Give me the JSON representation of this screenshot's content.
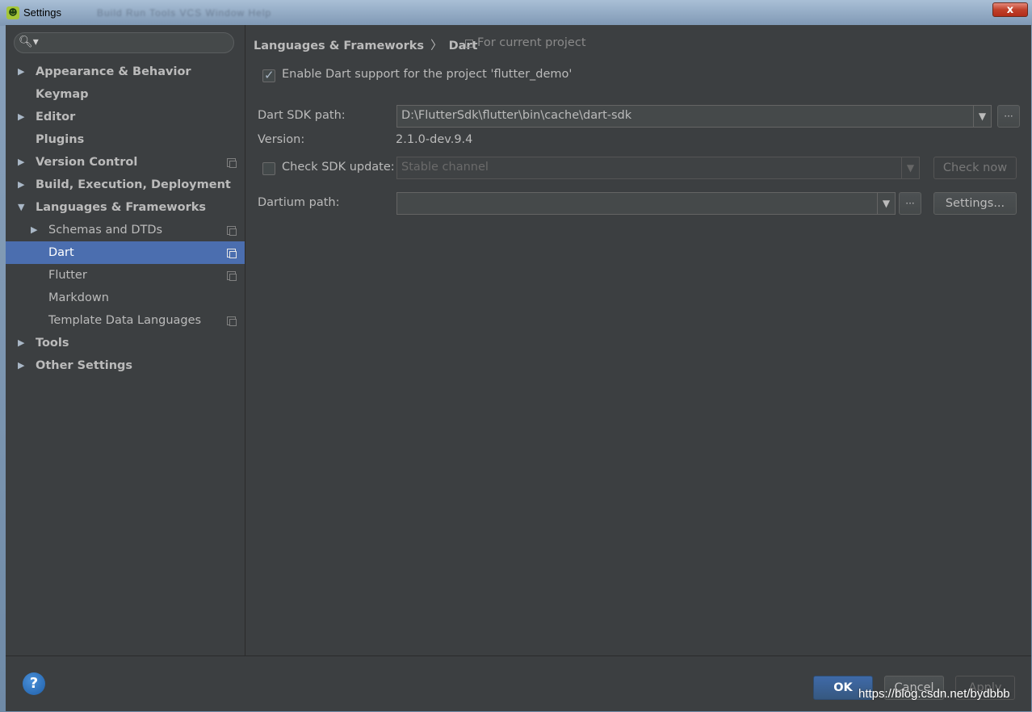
{
  "window": {
    "title": "Settings",
    "ghost_menu": "Build   Run   Tools   VCS   Window   Help",
    "close_glyph": "x",
    "app_icon": "android-studio-icon"
  },
  "search": {
    "value": "",
    "placeholder": ""
  },
  "sidebar": {
    "items": [
      {
        "label": "Appearance & Behavior",
        "arrow": "▶",
        "bold": true,
        "indent": 0,
        "project_icon": false
      },
      {
        "label": "Keymap",
        "arrow": "",
        "bold": true,
        "indent": 0,
        "project_icon": false
      },
      {
        "label": "Editor",
        "arrow": "▶",
        "bold": true,
        "indent": 0,
        "project_icon": false
      },
      {
        "label": "Plugins",
        "arrow": "",
        "bold": true,
        "indent": 0,
        "project_icon": false
      },
      {
        "label": "Version Control",
        "arrow": "▶",
        "bold": true,
        "indent": 0,
        "project_icon": true
      },
      {
        "label": "Build, Execution, Deployment",
        "arrow": "▶",
        "bold": true,
        "indent": 0,
        "project_icon": false
      },
      {
        "label": "Languages & Frameworks",
        "arrow": "▼",
        "bold": true,
        "indent": 0,
        "project_icon": false
      },
      {
        "label": "Schemas and DTDs",
        "arrow": "▶",
        "bold": false,
        "indent": 1,
        "project_icon": true
      },
      {
        "label": "Dart",
        "arrow": "",
        "bold": false,
        "indent": 1,
        "project_icon": true,
        "selected": true
      },
      {
        "label": "Flutter",
        "arrow": "",
        "bold": false,
        "indent": 1,
        "project_icon": true
      },
      {
        "label": "Markdown",
        "arrow": "",
        "bold": false,
        "indent": 1,
        "project_icon": false
      },
      {
        "label": "Template Data Languages",
        "arrow": "",
        "bold": false,
        "indent": 1,
        "project_icon": true
      },
      {
        "label": "Tools",
        "arrow": "▶",
        "bold": true,
        "indent": 0,
        "project_icon": false
      },
      {
        "label": "Other Settings",
        "arrow": "▶",
        "bold": true,
        "indent": 0,
        "project_icon": false
      }
    ]
  },
  "breadcrumb": {
    "parent": "Languages & Frameworks",
    "separator": "〉",
    "current": "Dart",
    "scope_label": "For current project"
  },
  "dart": {
    "enable_label": "Enable Dart support for the project 'flutter_demo'",
    "enable_checked": true,
    "sdk_path_label": "Dart SDK path:",
    "sdk_path_value": "D:\\FlutterSdk\\flutter\\bin\\cache\\dart-sdk",
    "version_label": "Version:",
    "version_value": "2.1.0-dev.9.4",
    "check_update_label": "Check SDK update:",
    "check_update_checked": false,
    "channel_value": "Stable channel",
    "check_now_label": "Check now",
    "dartium_label": "Dartium path:",
    "dartium_value": "",
    "settings_label": "Settings...",
    "browse_label": "···",
    "dropdown_glyph": "▼"
  },
  "footer": {
    "help_glyph": "?",
    "ok_label": "OK",
    "cancel_label": "Cancel",
    "apply_label": "Apply"
  },
  "watermark": "https://blog.csdn.net/bydbbb",
  "colors": {
    "background": "#3c3f41",
    "selection": "#4b6eaf",
    "ok_button": "#365880",
    "help_button": "#2c72c7"
  }
}
